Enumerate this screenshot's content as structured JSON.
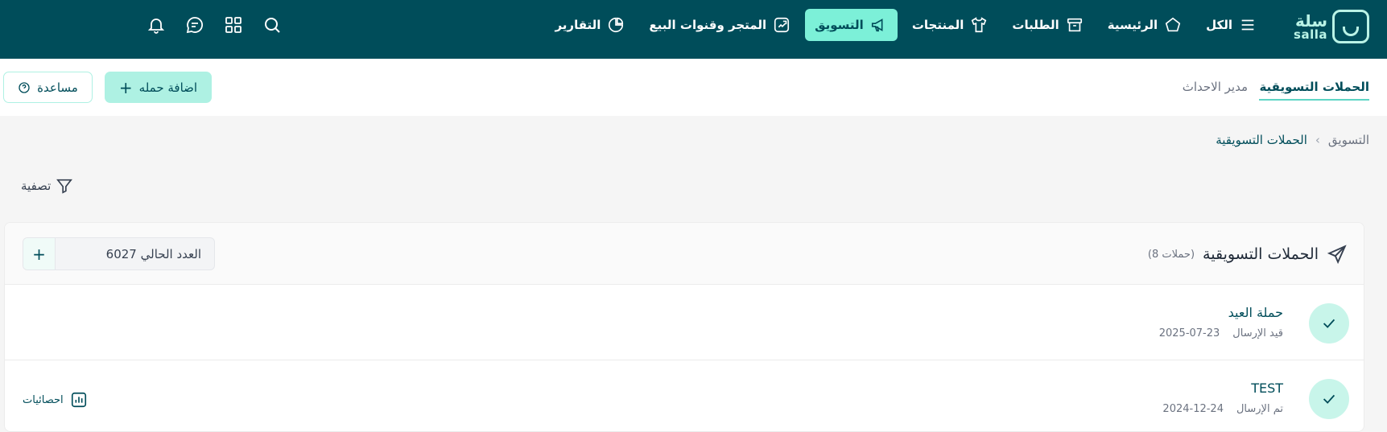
{
  "brand": {
    "name_ar": "سلة",
    "name_en": "salla"
  },
  "nav": {
    "items": [
      {
        "label": "الكل",
        "icon": "menu-icon"
      },
      {
        "label": "الرئيسية",
        "icon": "home-icon"
      },
      {
        "label": "الطلبات",
        "icon": "archive-box-icon"
      },
      {
        "label": "المنتجات",
        "icon": "shirt-icon"
      },
      {
        "label": "التسويق",
        "icon": "megaphone-icon"
      },
      {
        "label": "المتجر وقنوات البيع",
        "icon": "store-channels-icon"
      },
      {
        "label": "التقارير",
        "icon": "pie-chart-icon"
      }
    ],
    "active_index": 4
  },
  "utilities": [
    "search-icon",
    "apps-grid-icon",
    "chat-icon",
    "bell-icon"
  ],
  "subheader": {
    "tabs": [
      {
        "label": "الحملات التسويقية",
        "active": true
      },
      {
        "label": "مدير الاحداث",
        "active": false
      }
    ],
    "add_button": "اضافة حمله",
    "help_button": "مساعدة"
  },
  "breadcrumb": {
    "parent": "التسويق",
    "current": "الحملات التسويقية"
  },
  "filter_label": "تصفية",
  "card": {
    "title": "الحملات التسويقية",
    "count_label": "(8 حملات)",
    "counter_label": "العدد الحالي 6027"
  },
  "campaigns": [
    {
      "name": "حملة العيد",
      "status": "قيد الإرسال",
      "date": "2025-07-23",
      "stats_label": ""
    },
    {
      "name": "TEST",
      "status": "تم الإرسال",
      "date": "2024-12-24",
      "stats_label": "احصائيات"
    }
  ],
  "colors": {
    "nav_bg": "#004d5a",
    "accent": "#7cf0d8",
    "accent_soft": "#aef1e3",
    "text_primary": "#004d5a"
  }
}
